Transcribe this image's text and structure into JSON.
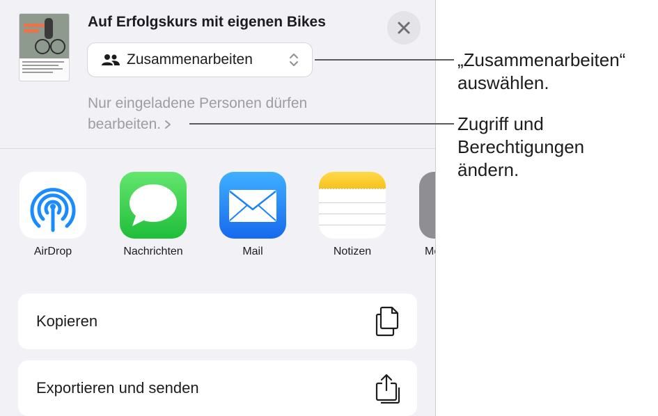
{
  "document": {
    "title": "Auf Erfolgskurs mit eigenen Bikes",
    "thumbnail_text": "CUSTOM BIKES"
  },
  "collaboration": {
    "mode_label": "Zusammenarbeiten",
    "permission_text": "Nur eingeladene Personen dürfen bearbeiten."
  },
  "apps": [
    {
      "name": "AirDrop",
      "icon": "airdrop-icon"
    },
    {
      "name": "Nachrichten",
      "icon": "messages-icon"
    },
    {
      "name": "Mail",
      "icon": "mail-icon"
    },
    {
      "name": "Notizen",
      "icon": "notes-icon"
    },
    {
      "name": "Mehr",
      "icon": "more-icon"
    }
  ],
  "actions": [
    {
      "label": "Kopieren",
      "icon": "copy-icon"
    },
    {
      "label": "Exportieren und senden",
      "icon": "share-icon"
    }
  ],
  "callouts": {
    "collaborate": "„Zusammenarbeiten“\nauswählen.",
    "access": "Zugriff und\nBerechtigungen\nändern."
  },
  "colors": {
    "sheet_background": "#f2f2f6",
    "secondary_text": "#9c9ca3",
    "messages_green": "#34c759",
    "mail_blue": "#1a82fb",
    "airdrop_blue": "#1a8cff",
    "notes_yellow": "#fcd12a"
  }
}
